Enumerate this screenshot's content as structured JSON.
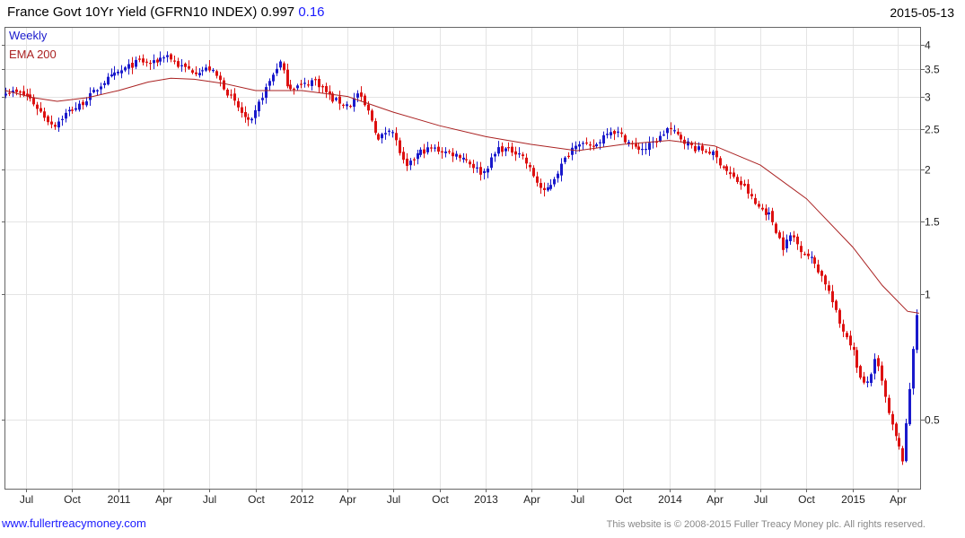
{
  "header": {
    "title": "France Govt 10Yr Yield (GFRN10 INDEX)",
    "last": "0.997",
    "change": "0.16",
    "date": "2015-05-13"
  },
  "footer": {
    "site": "www.fullertreacymoney.com",
    "copyright": "This website is © 2008-2015 Fuller Treacy Money plc. All rights reserved."
  },
  "legend": {
    "period": "Weekly",
    "ema": "EMA 200"
  },
  "colors": {
    "up": "#1a1acc",
    "down": "#dd1111",
    "ema": "#aa2222",
    "grid": "#e4e4e4",
    "axis": "#666666"
  },
  "chart_data": {
    "type": "ohlc",
    "title": "France Govt 10Yr Yield (GFRN10 INDEX)",
    "frequency": "weekly",
    "y_scale": "log",
    "ylim": [
      0.37,
      4.2
    ],
    "y_ticks": [
      0.5,
      1,
      1.5,
      2,
      2.5,
      3,
      3.5,
      4
    ],
    "x_range": [
      "2010-05-21",
      "2015-05-15"
    ],
    "x_ticks": [
      {
        "label": "Jul",
        "date": "2010-07-01"
      },
      {
        "label": "Oct",
        "date": "2010-10-01"
      },
      {
        "label": "2011",
        "date": "2011-01-01"
      },
      {
        "label": "Apr",
        "date": "2011-04-01"
      },
      {
        "label": "Jul",
        "date": "2011-07-01"
      },
      {
        "label": "Oct",
        "date": "2011-10-01"
      },
      {
        "label": "2012",
        "date": "2012-01-01"
      },
      {
        "label": "Apr",
        "date": "2012-04-01"
      },
      {
        "label": "Jul",
        "date": "2012-07-01"
      },
      {
        "label": "Oct",
        "date": "2012-10-01"
      },
      {
        "label": "2013",
        "date": "2013-01-01"
      },
      {
        "label": "Apr",
        "date": "2013-04-01"
      },
      {
        "label": "Jul",
        "date": "2013-07-01"
      },
      {
        "label": "Oct",
        "date": "2013-10-01"
      },
      {
        "label": "2014",
        "date": "2014-01-01"
      },
      {
        "label": "Apr",
        "date": "2014-04-01"
      },
      {
        "label": "Jul",
        "date": "2014-07-01"
      },
      {
        "label": "Oct",
        "date": "2014-10-01"
      },
      {
        "label": "2015",
        "date": "2015-01-01"
      },
      {
        "label": "Apr",
        "date": "2015-04-01"
      }
    ],
    "close_anchors": [
      [
        "2010-05-21",
        3.1
      ],
      [
        "2010-06-15",
        3.05
      ],
      [
        "2010-07-05",
        3.0
      ],
      [
        "2010-08-10",
        2.65
      ],
      [
        "2010-08-25",
        2.55
      ],
      [
        "2010-09-20",
        2.75
      ],
      [
        "2010-10-15",
        2.85
      ],
      [
        "2010-11-10",
        3.05
      ],
      [
        "2010-12-01",
        3.25
      ],
      [
        "2011-01-05",
        3.45
      ],
      [
        "2011-02-10",
        3.65
      ],
      [
        "2011-03-10",
        3.6
      ],
      [
        "2011-04-05",
        3.8
      ],
      [
        "2011-05-01",
        3.55
      ],
      [
        "2011-06-01",
        3.45
      ],
      [
        "2011-07-01",
        3.5
      ],
      [
        "2011-07-20",
        3.3
      ],
      [
        "2011-08-10",
        3.0
      ],
      [
        "2011-09-20",
        2.55
      ],
      [
        "2011-10-10",
        2.95
      ],
      [
        "2011-11-17",
        3.65
      ],
      [
        "2011-12-05",
        3.15
      ],
      [
        "2012-01-05",
        3.2
      ],
      [
        "2012-01-25",
        3.3
      ],
      [
        "2012-03-01",
        2.95
      ],
      [
        "2012-04-05",
        2.85
      ],
      [
        "2012-04-20",
        3.05
      ],
      [
        "2012-05-15",
        2.7
      ],
      [
        "2012-06-01",
        2.35
      ],
      [
        "2012-06-25",
        2.55
      ],
      [
        "2012-07-25",
        2.0
      ],
      [
        "2012-08-20",
        2.2
      ],
      [
        "2012-09-15",
        2.25
      ],
      [
        "2012-10-15",
        2.2
      ],
      [
        "2012-11-15",
        2.15
      ],
      [
        "2012-12-25",
        1.95
      ],
      [
        "2013-01-25",
        2.25
      ],
      [
        "2013-03-10",
        2.2
      ],
      [
        "2013-04-25",
        1.75
      ],
      [
        "2013-05-10",
        1.85
      ],
      [
        "2013-06-15",
        2.2
      ],
      [
        "2013-07-01",
        2.35
      ],
      [
        "2013-07-25",
        2.25
      ],
      [
        "2013-08-10",
        2.3
      ],
      [
        "2013-09-01",
        2.5
      ],
      [
        "2013-09-20",
        2.45
      ],
      [
        "2013-10-25",
        2.25
      ],
      [
        "2013-11-15",
        2.25
      ],
      [
        "2013-12-15",
        2.4
      ],
      [
        "2013-12-28",
        2.52
      ],
      [
        "2014-01-20",
        2.4
      ],
      [
        "2014-02-20",
        2.25
      ],
      [
        "2014-03-25",
        2.2
      ],
      [
        "2014-04-30",
        1.95
      ],
      [
        "2014-06-01",
        1.8
      ],
      [
        "2014-06-20",
        1.65
      ],
      [
        "2014-07-20",
        1.55
      ],
      [
        "2014-08-15",
        1.3
      ],
      [
        "2014-09-01",
        1.4
      ],
      [
        "2014-09-15",
        1.3
      ],
      [
        "2014-10-15",
        1.2
      ],
      [
        "2014-11-10",
        1.05
      ],
      [
        "2014-12-05",
        0.85
      ],
      [
        "2014-12-30",
        0.75
      ],
      [
        "2015-01-20",
        0.6
      ],
      [
        "2015-02-01",
        0.62
      ],
      [
        "2015-02-15",
        0.7
      ],
      [
        "2015-03-01",
        0.6
      ],
      [
        "2015-03-15",
        0.5
      ],
      [
        "2015-03-25",
        0.46
      ],
      [
        "2015-04-10",
        0.4
      ],
      [
        "2015-04-20",
        0.52
      ],
      [
        "2015-05-05",
        0.85
      ],
      [
        "2015-05-13",
        0.997
      ]
    ],
    "ema_anchors": [
      [
        "2010-05-21",
        3.1
      ],
      [
        "2010-07-15",
        2.98
      ],
      [
        "2010-09-01",
        2.92
      ],
      [
        "2010-11-01",
        2.98
      ],
      [
        "2011-01-01",
        3.1
      ],
      [
        "2011-03-01",
        3.25
      ],
      [
        "2011-04-15",
        3.32
      ],
      [
        "2011-06-01",
        3.3
      ],
      [
        "2011-08-01",
        3.22
      ],
      [
        "2011-10-01",
        3.1
      ],
      [
        "2012-01-01",
        3.1
      ],
      [
        "2012-04-01",
        3.0
      ],
      [
        "2012-07-01",
        2.75
      ],
      [
        "2012-10-01",
        2.55
      ],
      [
        "2013-01-01",
        2.4
      ],
      [
        "2013-04-01",
        2.3
      ],
      [
        "2013-07-01",
        2.22
      ],
      [
        "2013-10-01",
        2.3
      ],
      [
        "2014-01-01",
        2.35
      ],
      [
        "2014-04-01",
        2.28
      ],
      [
        "2014-07-01",
        2.05
      ],
      [
        "2014-10-01",
        1.7
      ],
      [
        "2015-01-01",
        1.3
      ],
      [
        "2015-03-01",
        1.05
      ],
      [
        "2015-04-20",
        0.91
      ],
      [
        "2015-05-13",
        0.9
      ]
    ]
  }
}
